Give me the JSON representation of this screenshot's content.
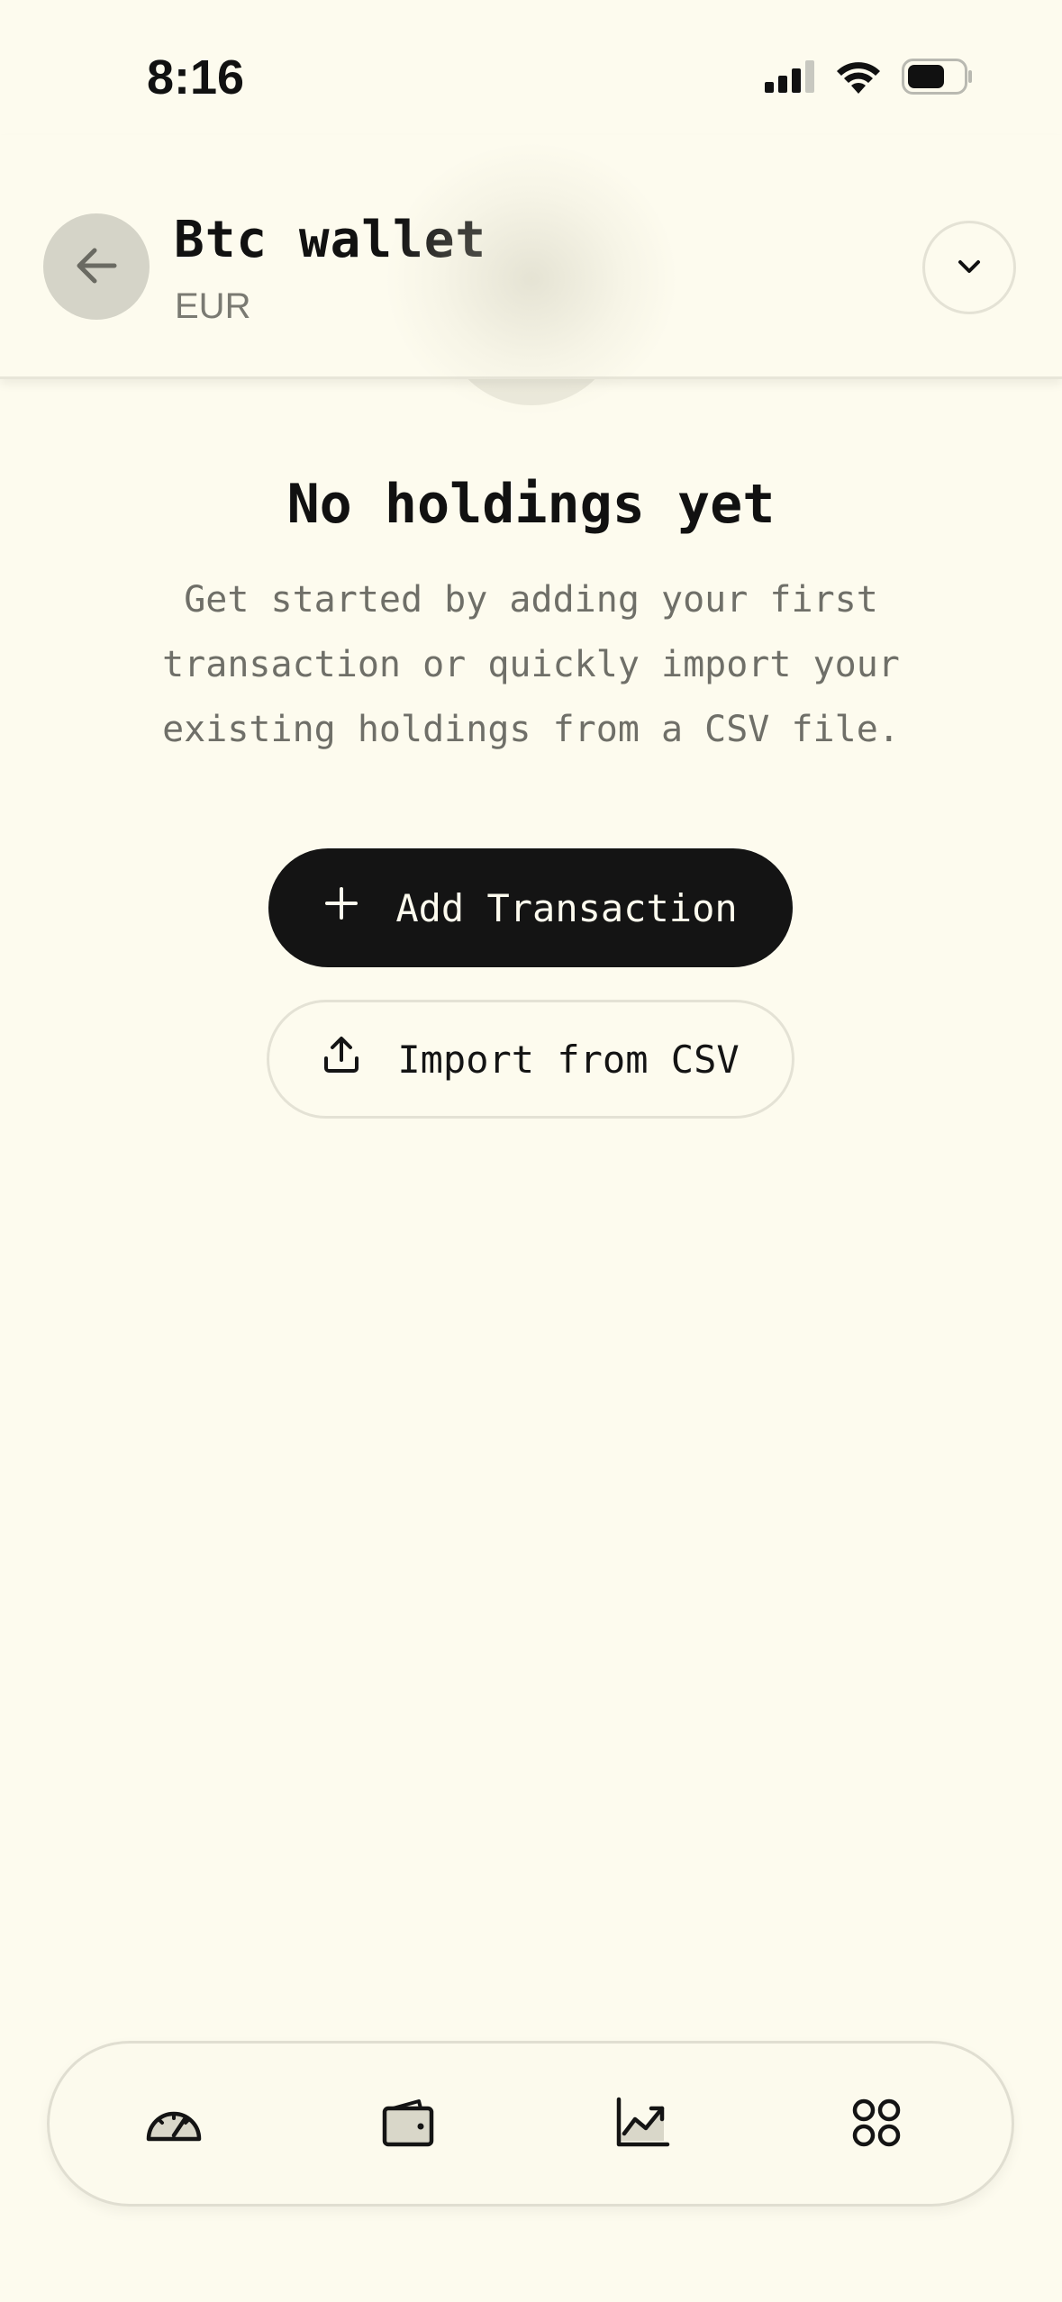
{
  "status_bar": {
    "time": "8:16"
  },
  "header": {
    "title": "Btc wallet",
    "subtitle": "EUR"
  },
  "empty_state": {
    "title": "No holdings yet",
    "description": "Get started by adding your first transaction or quickly import your existing holdings from a CSV file."
  },
  "actions": {
    "add_transaction": "Add Transaction",
    "import_csv": "Import from CSV"
  },
  "tab_bar": {
    "tabs": [
      {
        "icon": "dashboard-gauge-icon"
      },
      {
        "icon": "wallet-icon"
      },
      {
        "icon": "chart-line-icon"
      },
      {
        "icon": "apps-grid-icon"
      }
    ]
  },
  "colors": {
    "background": "#fdfbee",
    "primary": "#141414",
    "muted_text": "#6f6f68",
    "back_button": "#d5d4c8"
  }
}
